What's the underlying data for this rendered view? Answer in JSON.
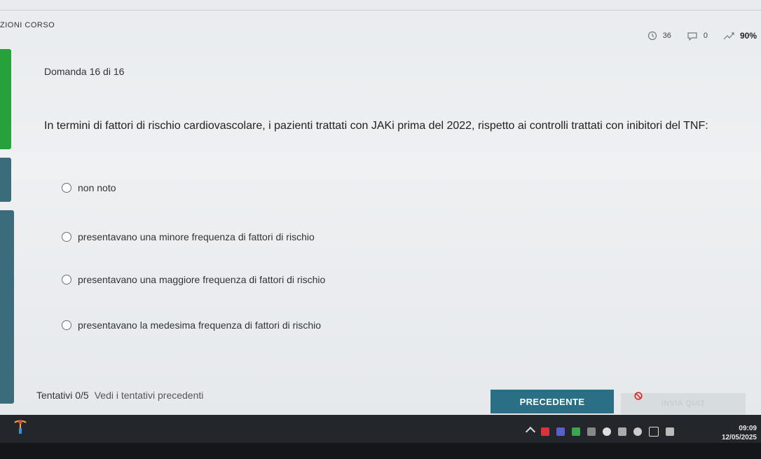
{
  "header": {
    "course_title": "ZIONI CORSO",
    "stats": [
      {
        "icon": "clock-icon",
        "value": "36"
      },
      {
        "icon": "comment-icon",
        "value": "0"
      },
      {
        "icon": "trend-icon",
        "value": "90%"
      }
    ]
  },
  "question": {
    "number_label": "Domanda 16 di 16",
    "text": "In termini di fattori di rischio cardiovascolare, i pazienti trattati con JAKi prima del 2022, rispetto ai controlli trattati con inibitori del TNF:",
    "options": [
      "non noto",
      "presentavano una minore frequenza di fattori di rischio",
      "presentavano una maggiore frequenza di fattori di rischio",
      "presentavano la medesima frequenza di fattori di rischio"
    ]
  },
  "footer": {
    "attempts": "Tentativi 0/5",
    "previous_attempts_link": "Vedi i tentativi precedenti",
    "prev_button": "PRECEDENTE",
    "submit_button": "INVIA QUIZ"
  },
  "taskbar": {
    "time": "09:09",
    "date": "12/05/2025"
  },
  "colors": {
    "accent_green": "#27a13b",
    "accent_teal": "#2a6f86"
  }
}
